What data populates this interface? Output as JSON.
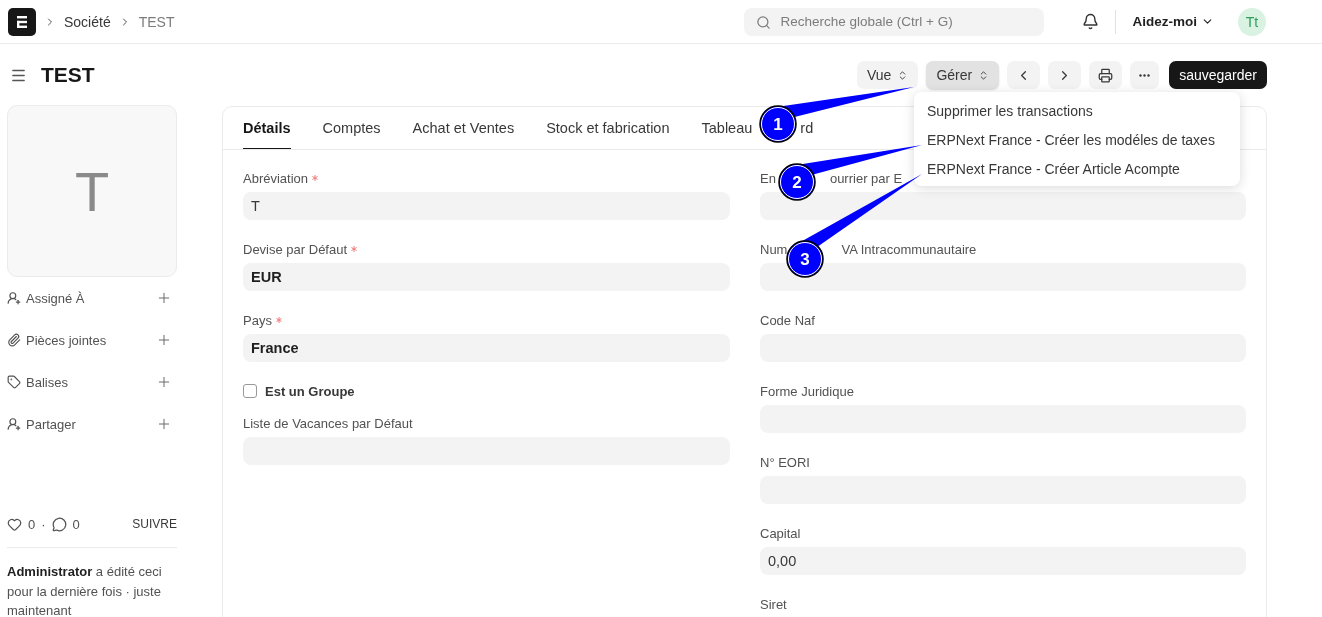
{
  "breadcrumbs": [
    "Société",
    "TEST"
  ],
  "search": {
    "placeholder": "Recherche globale (Ctrl + G)"
  },
  "help_menu": "Aidez-moi",
  "avatar": "Tt",
  "page_title": "TEST",
  "actions": [
    {
      "kind": "select",
      "label": "Vue",
      "selected": false
    },
    {
      "kind": "select",
      "label": "Gérer",
      "selected": true
    },
    {
      "kind": "prev"
    },
    {
      "kind": "next"
    },
    {
      "kind": "print"
    },
    {
      "kind": "more"
    },
    {
      "kind": "primary",
      "label": "sauvegarder"
    }
  ],
  "dropdown": [
    "Supprimer les transactions",
    "ERPNext France - Créer les modéles de taxes",
    "ERPNext France - Créer Article Acompte"
  ],
  "image_letter": "T",
  "sidebar_items": [
    {
      "kind": "assign",
      "label": "Assigné À"
    },
    {
      "kind": "attachment",
      "label": "Pièces jointes"
    },
    {
      "kind": "tag",
      "label": "Balises"
    },
    {
      "kind": "share",
      "label": "Partager"
    }
  ],
  "likes": "0",
  "separator": "·",
  "comments": "0",
  "follow": "SUIVRE",
  "activity": "**Administrator** a édité ceci pour la dernière fois · juste maintenant",
  "tabs": [
    {
      "label": "Détails",
      "selected": true
    },
    {
      "label": "Comptes",
      "selected": false
    },
    {
      "label": "Achat et Ventes",
      "selected": false
    },
    {
      "label": "Stock et fabrication",
      "selected": false
    },
    {
      "label": "Tableau",
      "label_tail": "rd",
      "selected": false
    }
  ],
  "left_fields": [
    {
      "kind": "text",
      "label": "Abréviation",
      "required": true,
      "value": "T"
    },
    {
      "kind": "link",
      "label": "Devise par Défaut",
      "required": true,
      "value": "EUR"
    },
    {
      "kind": "link",
      "label": "Pays",
      "required": true,
      "value": "France"
    },
    {
      "kind": "checkbox",
      "label": "Est un Groupe",
      "checked": false
    },
    {
      "kind": "link",
      "label": "Liste de Vacances par Défaut",
      "required": false
    }
  ],
  "right_fields": [
    {
      "kind": "text",
      "label": "En",
      "label_tail": "ourrier par E",
      "required": false
    },
    {
      "kind": "text",
      "label": "Num",
      "label_tail": "VA Intracommunautaire",
      "required": false
    },
    {
      "kind": "text",
      "label": "Code Naf",
      "required": false
    },
    {
      "kind": "text",
      "label": "Forme Juridique",
      "required": false
    },
    {
      "kind": "text",
      "label": "N° EORI",
      "required": false
    },
    {
      "kind": "text",
      "label": "Capital",
      "required": false,
      "value": "0,00"
    },
    {
      "kind": "label",
      "label": "Siret",
      "required": false
    }
  ],
  "callouts": [
    "1",
    "2",
    "3"
  ]
}
